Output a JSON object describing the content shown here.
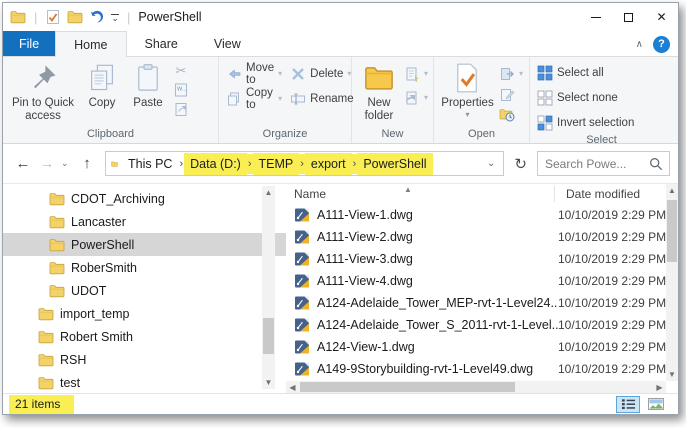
{
  "window": {
    "title": "PowerShell",
    "controls": {
      "minimize": "minimize",
      "maximize": "maximize",
      "close": "✕"
    },
    "help": "?"
  },
  "tabs": {
    "file": "File",
    "home": "Home",
    "share": "Share",
    "view": "View"
  },
  "ribbon": {
    "clipboard": {
      "label": "Clipboard",
      "pin": "Pin to Quick\naccess",
      "copy": "Copy",
      "paste": "Paste"
    },
    "organize": {
      "label": "Organize",
      "move_to": "Move to",
      "copy_to": "Copy to",
      "delete": "Delete",
      "rename": "Rename"
    },
    "new_group": {
      "label": "New",
      "new_folder": "New\nfolder"
    },
    "open_group": {
      "label": "Open",
      "properties": "Properties"
    },
    "select_group": {
      "label": "Select",
      "select_all": "Select all",
      "select_none": "Select none",
      "invert": "Invert selection"
    }
  },
  "navbar": {
    "breadcrumb": [
      {
        "label": "This PC",
        "highlight": false
      },
      {
        "label": "Data (D:)",
        "highlight": true
      },
      {
        "label": "TEMP",
        "highlight": true
      },
      {
        "label": "export",
        "highlight": true
      },
      {
        "label": "PowerShell",
        "highlight": true
      }
    ],
    "search_placeholder": "Search Powe..."
  },
  "tree": {
    "items": [
      {
        "label": "CDOT_Archiving",
        "level": 2,
        "selected": false
      },
      {
        "label": "Lancaster",
        "level": 2,
        "selected": false
      },
      {
        "label": "PowerShell",
        "level": 2,
        "selected": true
      },
      {
        "label": "RoberSmith",
        "level": 2,
        "selected": false
      },
      {
        "label": "UDOT",
        "level": 2,
        "selected": false
      },
      {
        "label": "import_temp",
        "level": 1,
        "selected": false
      },
      {
        "label": "Robert Smith",
        "level": 1,
        "selected": false
      },
      {
        "label": "RSH",
        "level": 1,
        "selected": false
      },
      {
        "label": "test",
        "level": 1,
        "selected": false
      }
    ]
  },
  "list": {
    "columns": {
      "name": "Name",
      "date": "Date modified"
    },
    "files": [
      {
        "name": "A111-View-1.dwg",
        "date": "10/10/2019 2:29 PM"
      },
      {
        "name": "A111-View-2.dwg",
        "date": "10/10/2019 2:29 PM"
      },
      {
        "name": "A111-View-3.dwg",
        "date": "10/10/2019 2:29 PM"
      },
      {
        "name": "A111-View-4.dwg",
        "date": "10/10/2019 2:29 PM"
      },
      {
        "name": "A124-Adelaide_Tower_MEP-rvt-1-Level24...",
        "date": "10/10/2019 2:29 PM"
      },
      {
        "name": "A124-Adelaide_Tower_S_2011-rvt-1-Level...",
        "date": "10/10/2019 2:29 PM"
      },
      {
        "name": "A124-View-1.dwg",
        "date": "10/10/2019 2:29 PM"
      },
      {
        "name": "A149-9Storybuilding-rvt-1-Level49.dwg",
        "date": "10/10/2019 2:29 PM"
      }
    ]
  },
  "status": {
    "items_count": "21 items"
  },
  "colors": {
    "accent_blue": "#1270bf",
    "highlight_yellow": "#f9ef55",
    "folder_yellow": "#f3d367",
    "selection_gray": "#d6d6d6",
    "help_blue": "#1b7fd4"
  }
}
